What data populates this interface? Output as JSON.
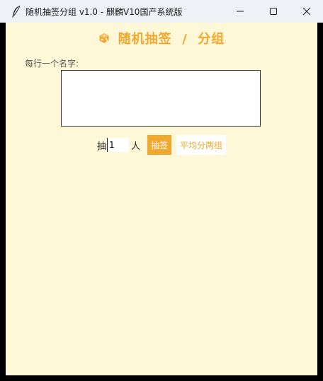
{
  "window": {
    "title": "随机抽签分组  v1.0  -  麒麟V10国产系统版",
    "icon": "feather-icon",
    "controls": [
      "minimize-icon",
      "maximize-icon",
      "close-icon"
    ]
  },
  "header": {
    "icon": "dice-icon",
    "title": "随机抽签  /  分组"
  },
  "names": {
    "label": "每行一个名字:",
    "value": "",
    "placeholder": ""
  },
  "draw": {
    "prefix": "抽",
    "count_value": "1",
    "suffix": "人",
    "draw_button": "抽签",
    "split_button": "平均分两组"
  },
  "colors": {
    "accent": "#f0a92e",
    "background": "#fef7d8",
    "titlebar": "#eef2f7"
  }
}
